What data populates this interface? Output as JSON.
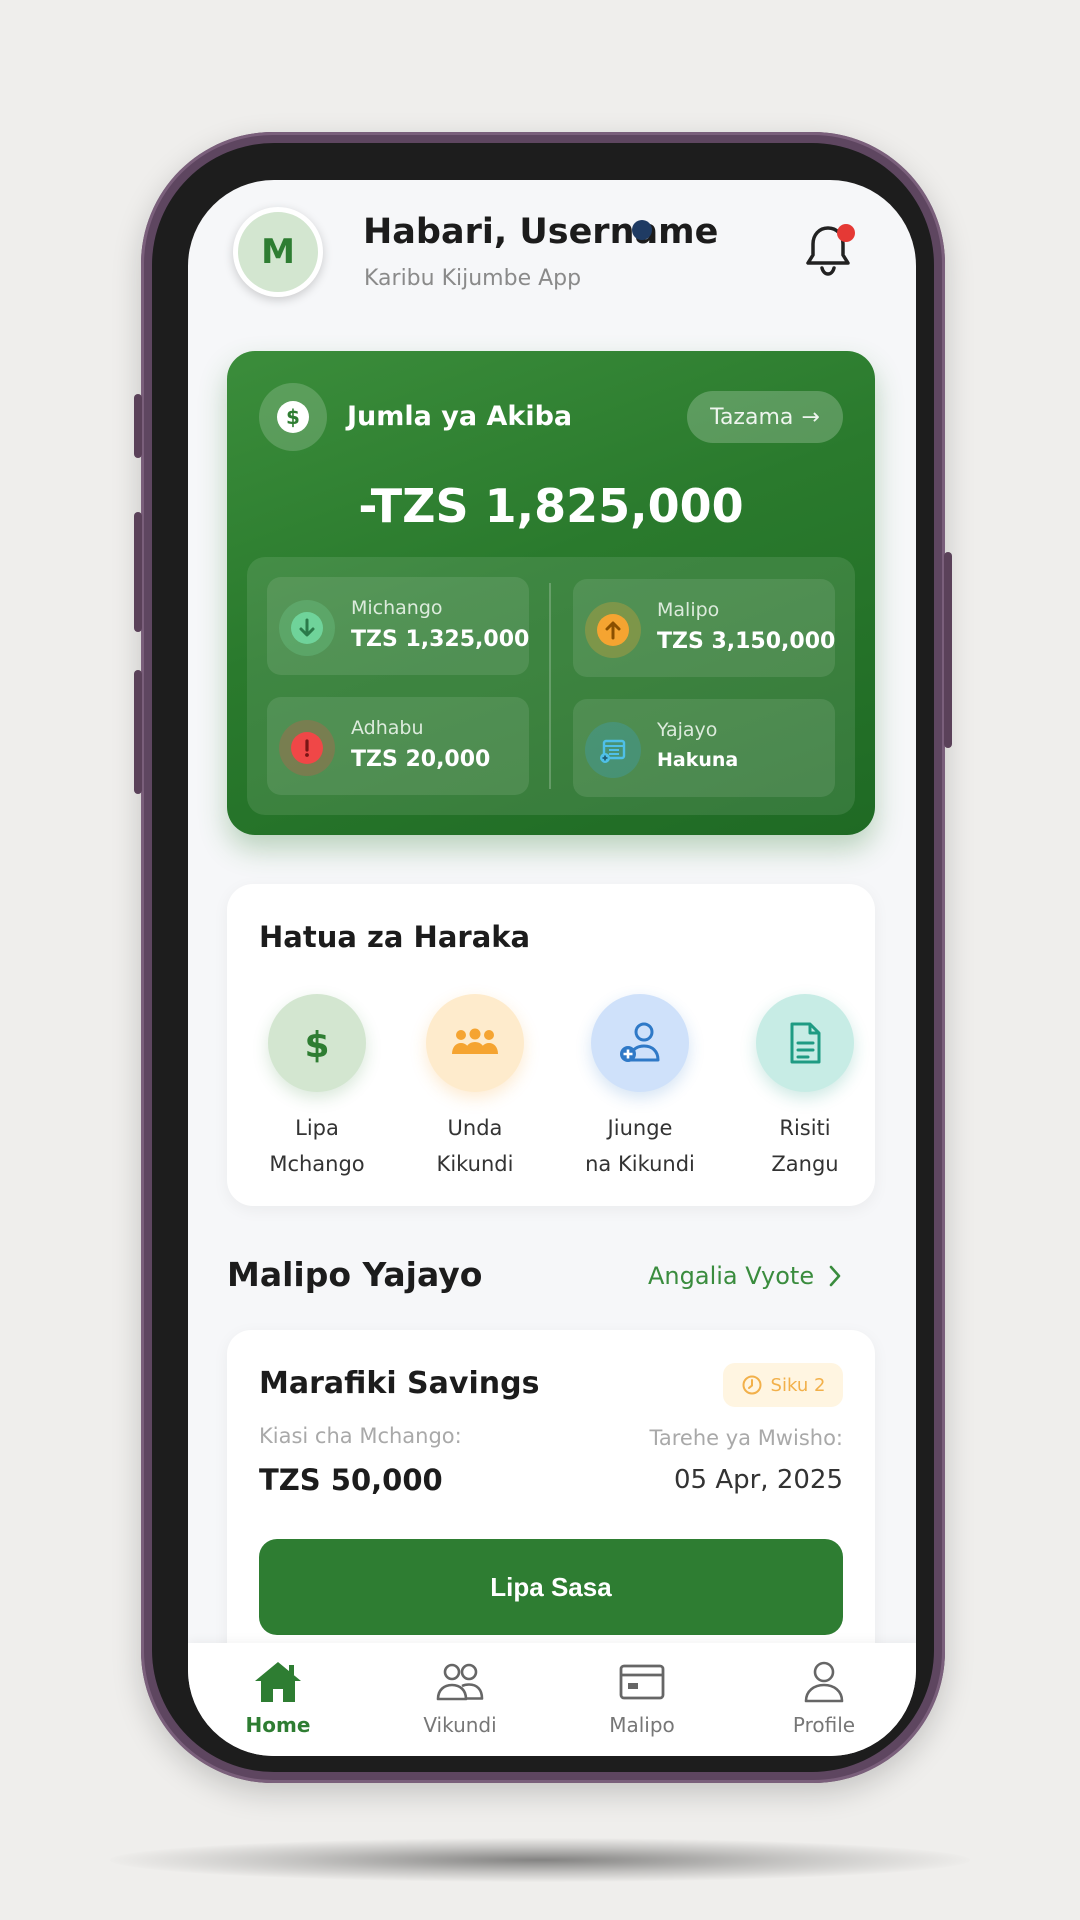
{
  "header": {
    "avatar_initial": "M",
    "greeting": "Habari, Username",
    "subtitle": "Karibu Kijumbe App",
    "notification_icon": "bell-icon",
    "notification_dot_color": "#e53935"
  },
  "savings_card": {
    "title": "Jumla ya Akiba",
    "icon": "dollar-icon",
    "view_button": "Tazama",
    "view_arrow": "→",
    "total": "-TZS 1,825,000",
    "stats": [
      {
        "label": "Michango",
        "value": "TZS 1,325,000",
        "icon": "arrow-down-icon",
        "color": "#4caf79"
      },
      {
        "label": "Malipo",
        "value": "TZS 3,150,000",
        "icon": "arrow-up-icon",
        "color": "#f5a431"
      },
      {
        "label": "Adhabu",
        "value": "TZS 20,000",
        "icon": "alert-icon",
        "color": "#f04747"
      },
      {
        "label": "Yajayo",
        "value": "Hakuna",
        "icon": "calendar-add-icon",
        "color": "#3aa1c9"
      }
    ],
    "gradient_color": "#2e7d32"
  },
  "quick_actions": {
    "title": "Hatua za Haraka",
    "items": [
      {
        "line1": "Lipa",
        "line2": "Mchango",
        "icon": "dollar-sign-icon",
        "color": "#2e7d32"
      },
      {
        "line1": "Unda",
        "line2": "Kikundi",
        "icon": "group-icon",
        "color": "#f5a431"
      },
      {
        "line1": "Jiunge",
        "line2": "na Kikundi",
        "icon": "user-add-icon",
        "color": "#2f79c7"
      },
      {
        "line1": "Risiti",
        "line2": "Zangu",
        "icon": "receipt-icon",
        "color": "#1f9b83"
      }
    ]
  },
  "upcoming": {
    "title": "Malipo Yajayo",
    "see_all": "Angalia Vyote",
    "card": {
      "group_name": "Marafiki Savings",
      "days_badge": "Siku 2",
      "amount_label": "Kiasi cha Mchango:",
      "amount": "TZS 50,000",
      "due_label": "Tarehe ya Mwisho:",
      "due_date": "05 Apr, 2025",
      "pay_button": "Lipa Sasa"
    }
  },
  "bottom_nav": {
    "items": [
      {
        "label": "Home",
        "icon": "home-icon",
        "active": true
      },
      {
        "label": "Vikundi",
        "icon": "people-icon",
        "active": false
      },
      {
        "label": "Malipo",
        "icon": "card-icon",
        "active": false
      },
      {
        "label": "Profile",
        "icon": "user-icon",
        "active": false
      }
    ]
  },
  "colors": {
    "brand_green": "#2e7d32",
    "background": "#f6f7f9",
    "phone_frame": "#5e4660"
  }
}
